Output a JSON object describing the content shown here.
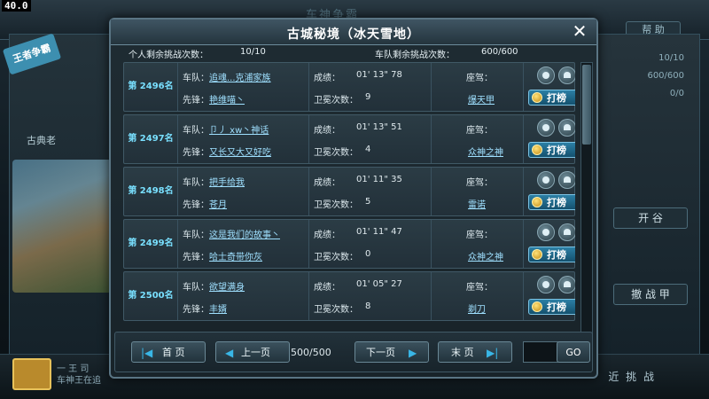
{
  "fps": "40.0",
  "background": {
    "title": "车神争霸",
    "help_label": "帮 助",
    "banner_label": "王者争霸",
    "left_label": "古典老",
    "right_stats": [
      "10/10",
      "600/600",
      "0/0"
    ],
    "right_buttons": [
      "开 谷",
      "撤 战 甲"
    ],
    "bottom_text": [
      "一 王 司",
      "车神王在追"
    ],
    "bottom_right_label": "近 挑 战"
  },
  "dialog": {
    "title": "古城秘境（冰天雪地）",
    "personal_label": "个人剩余挑战次数：",
    "personal_value": "10/10",
    "team_label": "车队剩余挑战次数：",
    "team_value": "600/600"
  },
  "labels": {
    "team": "车队：",
    "vanguard": "先锋：",
    "score": "成绩：",
    "defense": "卫冕次数：",
    "car": "座驾：",
    "fight": "打榜"
  },
  "rows": [
    {
      "rank": "第 2496名",
      "team": "追魂...克浦家族",
      "vanguard": "艳维喵丶",
      "score": "01' 13\" 78",
      "defense": "9",
      "car": "爆天甲"
    },
    {
      "rank": "第 2497名",
      "team": "卩丿 xw丶神话",
      "vanguard": "又长又大又好吃",
      "score": "01' 13\" 51",
      "defense": "4",
      "car": "众神之神"
    },
    {
      "rank": "第 2498名",
      "team": "把手给我",
      "vanguard": "苍月",
      "score": "01' 11\" 35",
      "defense": "5",
      "car": "雷诺"
    },
    {
      "rank": "第 2499名",
      "team": "这是我们的故事丶",
      "vanguard": "哈士奇带你灰",
      "score": "01' 11\" 47",
      "defense": "0",
      "car": "众神之神"
    },
    {
      "rank": "第 2500名",
      "team": "欲望满身",
      "vanguard": "丰婿",
      "score": "01' 05\" 27",
      "defense": "8",
      "car": "剃刀"
    }
  ],
  "pager": {
    "first": "首 页",
    "prev": "上一页",
    "page": "500/500",
    "next": "下一页",
    "last": "末 页",
    "go": "GO"
  }
}
